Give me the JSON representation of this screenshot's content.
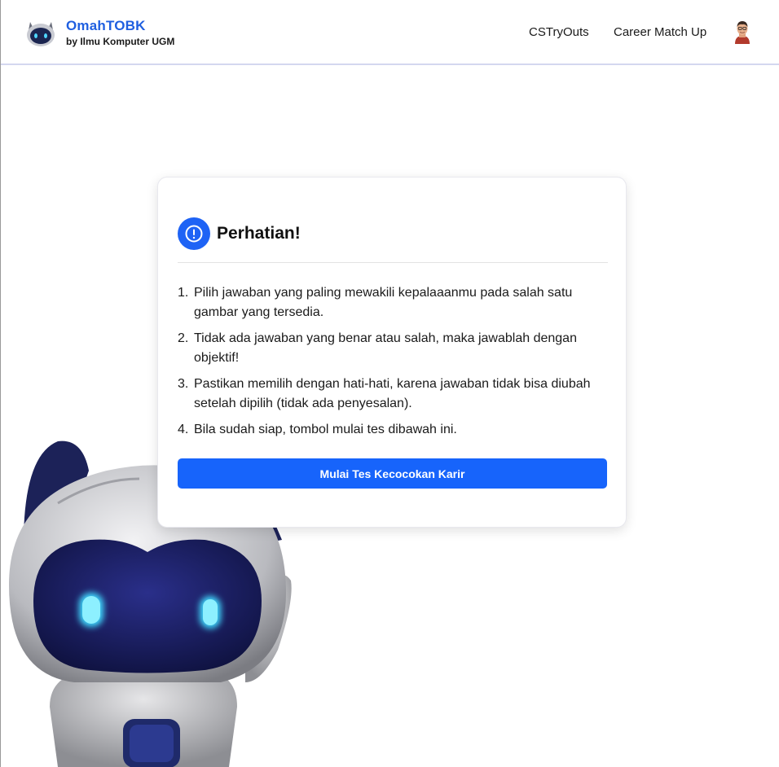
{
  "header": {
    "brand_name": "OmahTOBK",
    "brand_subtitle": "by Ilmu Komputer UGM",
    "logo_icon": "robot-head-logo-icon",
    "nav_links": [
      {
        "label": "CSTryOuts"
      },
      {
        "label": "Career Match Up"
      }
    ],
    "avatar_icon": "user-avatar-icon"
  },
  "card": {
    "title": "Perhatian!",
    "title_icon": "exclamation-circle-icon",
    "instructions": [
      {
        "num": "1.",
        "text": "Pilih jawaban yang paling mewakili kepalaaanmu pada salah satu gambar yang tersedia."
      },
      {
        "num": "2.",
        "text": "Tidak ada jawaban yang benar atau salah, maka jawablah dengan objektif!"
      },
      {
        "num": "3.",
        "text": "Pastikan memilih dengan hati-hati, karena jawaban tidak bisa diubah setelah dipilih (tidak ada penyesalan)."
      },
      {
        "num": "4.",
        "text": "Bila sudah siap, tombol mulai tes dibawah ini."
      }
    ],
    "button_label": "Mulai Tes Kecocokan Karir"
  },
  "mascot_icon": "robot-mascot-illustration",
  "colors": {
    "primary": "#1764fb",
    "brand_text": "#1f5fe0",
    "navbar_border": "#d4d7ef"
  }
}
